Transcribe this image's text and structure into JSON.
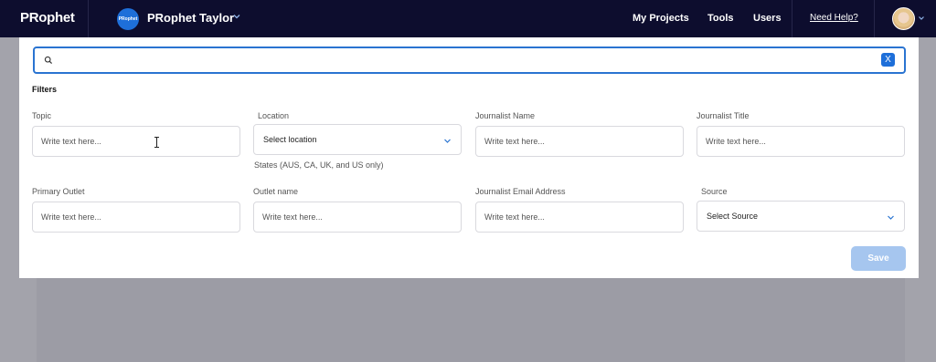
{
  "topbar": {
    "brand": "PRophet",
    "project_logo_text": "PRophet",
    "project_name": "PRophet Taylor",
    "nav": [
      "My Projects",
      "Tools",
      "Users"
    ],
    "help": "Need Help?"
  },
  "search": {
    "value": "",
    "placeholder": "",
    "clear_label": "X"
  },
  "filters": {
    "title": "Filters",
    "fields": {
      "topic": {
        "label": "Topic",
        "placeholder": "Write text here..."
      },
      "location": {
        "label": "Location",
        "value": "Select location",
        "hint": "States (AUS, CA, UK, and US only)"
      },
      "journalist_name": {
        "label": "Journalist Name",
        "placeholder": "Write text here..."
      },
      "journalist_title": {
        "label": "Journalist Title",
        "placeholder": "Write text here..."
      },
      "primary_outlet": {
        "label": "Primary Outlet",
        "placeholder": "Write text here..."
      },
      "outlet_name": {
        "label": "Outlet name",
        "placeholder": "Write text here..."
      },
      "journalist_email": {
        "label": "Journalist Email Address",
        "placeholder": "Write text here..."
      },
      "source": {
        "label": "Source",
        "value": "Select Source"
      }
    },
    "save_label": "Save"
  },
  "colors": {
    "nav_bg": "#0d0d2e",
    "accent": "#1e6fd9",
    "save_disabled": "#a6c6ef",
    "overlay": "#a3a3ab"
  },
  "icons": {
    "search": "search-icon",
    "clear": "close-icon",
    "chevron": "chevron-down-icon",
    "cursor": "text-cursor-icon"
  }
}
